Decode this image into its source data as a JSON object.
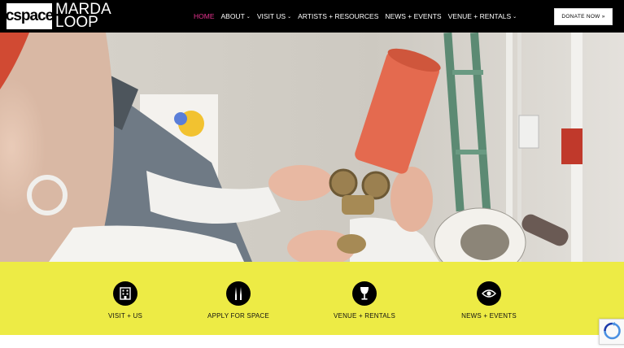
{
  "brand": {
    "logo_box": "cspace",
    "line1": "MARDA",
    "line2": "LOOP"
  },
  "nav": {
    "items": [
      {
        "label": "HOME",
        "caret": ""
      },
      {
        "label": "ABOUT",
        "caret": "⌄"
      },
      {
        "label": "VISIT US",
        "caret": "⌄"
      },
      {
        "label": "ARTISTS + RESOURCES",
        "caret": ""
      },
      {
        "label": "NEWS + EVENTS",
        "caret": ""
      },
      {
        "label": "VENUE + RENTALS",
        "caret": "⌄"
      }
    ],
    "active_color": "#e6338f"
  },
  "donate": {
    "label": "DONATE NOW »"
  },
  "features": [
    {
      "label": "VISIT + US",
      "icon": "building-icon"
    },
    {
      "label": "APPLY FOR SPACE",
      "icon": "brushes-icon"
    },
    {
      "label": "VENUE + RENTALS",
      "icon": "wine-glass-icon"
    },
    {
      "label": "NEWS + EVENTS",
      "icon": "eye-icon"
    }
  ],
  "colors": {
    "header": "#000000",
    "band": "#edeb45",
    "accent": "#e6338f"
  }
}
